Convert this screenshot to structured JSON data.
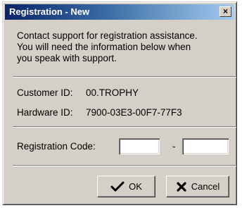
{
  "window": {
    "title": "Registration - New",
    "close_glyph": "×"
  },
  "message": {
    "lines": [
      "Contact support for registration assistance.",
      "You will need the information below when",
      "you speak with support."
    ]
  },
  "info": {
    "customer_id_label": "Customer ID:",
    "customer_id_value": "00.TROPHY",
    "hardware_id_label": "Hardware ID:",
    "hardware_id_value": "7900-03E3-00F7-77F3"
  },
  "registration": {
    "label": "Registration Code:",
    "field1_value": "",
    "separator": "-",
    "field2_value": ""
  },
  "buttons": {
    "ok_label": "OK",
    "ok_icon": "checkmark-icon",
    "cancel_label": "Cancel",
    "cancel_icon": "x-icon"
  }
}
